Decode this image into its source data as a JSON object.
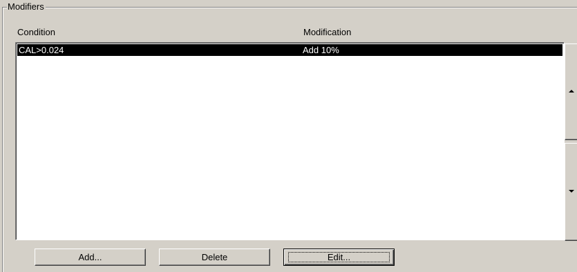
{
  "group": {
    "title": "Modifiers"
  },
  "columns": {
    "condition": "Condition",
    "modification": "Modification"
  },
  "rows": [
    {
      "condition": "CAL>0.024",
      "modification": "Add 10%",
      "selected": true
    }
  ],
  "buttons": {
    "add": "Add...",
    "delete": "Delete",
    "edit": "Edit..."
  },
  "icons": {
    "scroll_up": "triangle-up-icon",
    "scroll_down": "triangle-down-icon"
  },
  "colors": {
    "face": "#d4d0c8",
    "selection": "#000000",
    "list_background": "#ffffff"
  }
}
